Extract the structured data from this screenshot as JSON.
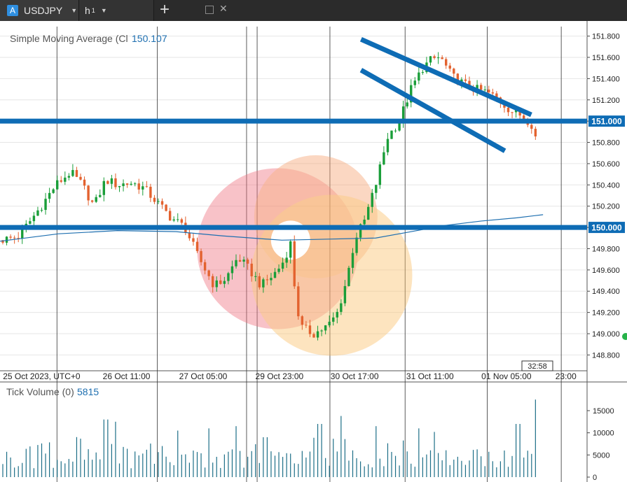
{
  "tabs": {
    "symbol": "USDJPY",
    "symbol_badge": "A",
    "timeframe": "h",
    "timeframe_sub": "1",
    "add_tab": "+"
  },
  "colors": {
    "up": "#1a9e39",
    "down": "#e3622f",
    "sma": "#1e6fb0",
    "hline": "#0e6cb5",
    "volume": "#1c6e87",
    "grid_v": "#333333",
    "grid_h": "#e6e6e6",
    "watermark": [
      "#ee6f7d",
      "#f5a16f",
      "#f9c06a"
    ]
  },
  "main_panel": {
    "indicator_label": "Simple Moving Average (Cl",
    "indicator_value": "150.107"
  },
  "volume_panel": {
    "label": "Tick Volume (0)",
    "value": "5815"
  },
  "price_axis": {
    "ticks": [
      "151.800",
      "151.600",
      "151.400",
      "151.200",
      "151.000",
      "150.800",
      "150.600",
      "150.400",
      "150.200",
      "150.000",
      "149.800",
      "149.600",
      "149.400",
      "149.200",
      "149.000",
      "148.800"
    ],
    "badges": [
      {
        "name": "level-151",
        "text": "151.000",
        "price": 151.0
      },
      {
        "name": "level-150",
        "text": "150.000",
        "price": 150.0
      }
    ]
  },
  "time_axis": {
    "labels": [
      "25 Oct 2023, UTC+0",
      "26 Oct 11:00",
      "27 Oct 05:00",
      "29 Oct 23:00",
      "30 Oct 17:00",
      "31 Oct 11:00",
      "01 Nov 05:00",
      "23:00"
    ],
    "countdown": "32:58"
  },
  "volume_axis": {
    "ticks": [
      "15000",
      "10000",
      "5000",
      "0"
    ]
  },
  "chart_data": {
    "type": "candlestick",
    "symbol": "USDJPY",
    "timeframe": "H1",
    "ylim": [
      148.75,
      151.85
    ],
    "volume_ylim": [
      0,
      18000
    ],
    "horizontal_lines": [
      151.0,
      150.0
    ],
    "trend_channel": {
      "upper": {
        "start": [
          0.615,
          151.77
        ],
        "end": [
          0.905,
          151.06
        ]
      },
      "lower": {
        "start": [
          0.615,
          151.48
        ],
        "end": [
          0.86,
          150.72
        ]
      }
    },
    "sma_last": 150.107,
    "volume_last": 5815,
    "close_anchors": [
      [
        0.0,
        149.88
      ],
      [
        0.03,
        149.91
      ],
      [
        0.05,
        150.05
      ],
      [
        0.07,
        150.2
      ],
      [
        0.095,
        150.4
      ],
      [
        0.12,
        150.52
      ],
      [
        0.14,
        150.4
      ],
      [
        0.16,
        150.2
      ],
      [
        0.18,
        150.45
      ],
      [
        0.2,
        150.4
      ],
      [
        0.225,
        150.42
      ],
      [
        0.245,
        150.37
      ],
      [
        0.265,
        150.25
      ],
      [
        0.29,
        150.1
      ],
      [
        0.315,
        150.0
      ],
      [
        0.335,
        149.75
      ],
      [
        0.35,
        149.6
      ],
      [
        0.365,
        149.45
      ],
      [
        0.385,
        149.52
      ],
      [
        0.405,
        149.72
      ],
      [
        0.425,
        149.6
      ],
      [
        0.445,
        149.45
      ],
      [
        0.465,
        149.55
      ],
      [
        0.48,
        149.65
      ],
      [
        0.495,
        149.85
      ],
      [
        0.505,
        149.25
      ],
      [
        0.515,
        149.05
      ],
      [
        0.535,
        149.0
      ],
      [
        0.56,
        149.08
      ],
      [
        0.575,
        149.2
      ],
      [
        0.59,
        149.5
      ],
      [
        0.605,
        149.9
      ],
      [
        0.62,
        150.05
      ],
      [
        0.64,
        150.4
      ],
      [
        0.66,
        150.85
      ],
      [
        0.68,
        151.0
      ],
      [
        0.7,
        151.3
      ],
      [
        0.72,
        151.5
      ],
      [
        0.735,
        151.58
      ],
      [
        0.75,
        151.6
      ],
      [
        0.77,
        151.42
      ],
      [
        0.79,
        151.35
      ],
      [
        0.81,
        151.3
      ],
      [
        0.83,
        151.27
      ],
      [
        0.85,
        151.2
      ],
      [
        0.87,
        151.1
      ],
      [
        0.89,
        151.05
      ],
      [
        0.905,
        150.98
      ],
      [
        0.915,
        150.8
      ]
    ],
    "sma_anchors": [
      [
        0.0,
        149.87
      ],
      [
        0.1,
        149.94
      ],
      [
        0.2,
        149.97
      ],
      [
        0.3,
        149.96
      ],
      [
        0.38,
        149.92
      ],
      [
        0.48,
        149.88
      ],
      [
        0.56,
        149.89
      ],
      [
        0.64,
        149.9
      ],
      [
        0.7,
        149.96
      ],
      [
        0.76,
        150.02
      ],
      [
        0.82,
        150.06
      ],
      [
        0.88,
        150.09
      ],
      [
        0.925,
        150.12
      ]
    ],
    "volume_spikes": [
      [
        0.18,
        13000
      ],
      [
        0.195,
        12500
      ],
      [
        0.305,
        10500
      ],
      [
        0.358,
        11000
      ],
      [
        0.402,
        11500
      ],
      [
        0.452,
        9000
      ],
      [
        0.545,
        12000
      ],
      [
        0.58,
        13800
      ],
      [
        0.64,
        11500
      ],
      [
        0.715,
        11000
      ],
      [
        0.74,
        10200
      ],
      [
        0.882,
        12000
      ],
      [
        0.912,
        17500
      ]
    ]
  }
}
